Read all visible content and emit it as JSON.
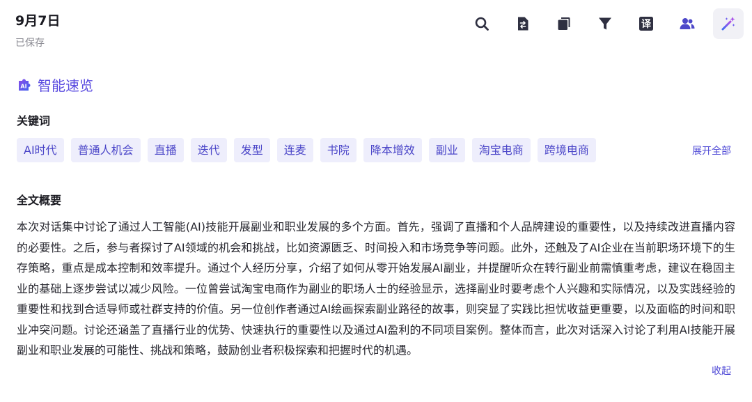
{
  "header": {
    "date": "9月7日",
    "status": "已保存"
  },
  "toolbar": {
    "icons": [
      "search-icon",
      "document-swap-icon",
      "copy-icon",
      "filter-icon",
      "translate-icon",
      "users-icon",
      "magic-wand-icon"
    ],
    "translate_glyph": "译",
    "active": "magic-wand-icon"
  },
  "ai_summary": {
    "title": "智能速览",
    "logo_text": "AI"
  },
  "keywords": {
    "heading": "关键词",
    "items": [
      "AI时代",
      "普通人机会",
      "直播",
      "迭代",
      "发型",
      "连麦",
      "书院",
      "降本增效",
      "副业",
      "淘宝电商",
      "跨境电商"
    ],
    "expand_label": "展开全部"
  },
  "summary": {
    "heading": "全文概要",
    "text": "本次对话集中讨论了通过人工智能(AI)技能开展副业和职业发展的多个方面。首先，强调了直播和个人品牌建设的重要性，以及持续改进直播内容的必要性。之后，参与者探讨了AI领域的机会和挑战，比如资源匮乏、时间投入和市场竞争等问题。此外，还触及了AI企业在当前职场环境下的生存策略，重点是成本控制和效率提升。通过个人经历分享，介绍了如何从零开始发展AI副业，并提醒听众在转行副业前需慎重考虑，建议在稳固主业的基础上逐步尝试以减少风险。一位曾尝试淘宝电商作为副业的职场人士的经验显示，选择副业时要考虑个人兴趣和实际情况，以及实践经验的重要性和找到合适导师或社群支持的价值。另一位创作者通过AI绘画探索副业路径的故事，则突显了实践比担忧收益更重要，以及面临的时间和职业冲突问题。讨论还涵盖了直播行业的优势、快速执行的重要性以及通过AI盈利的不同项目案例。整体而言，此次对话深入讨论了利用AI技能开展副业和职业发展的可能性、挑战和策略，鼓励创业者积极探索和把握时代的机遇。",
    "collapse_label": "收起"
  },
  "colors": {
    "accent": "#5b4ce0",
    "chip_bg": "#eeeefc",
    "chip_text": "#4a45c8",
    "icon": "#2f3041"
  }
}
